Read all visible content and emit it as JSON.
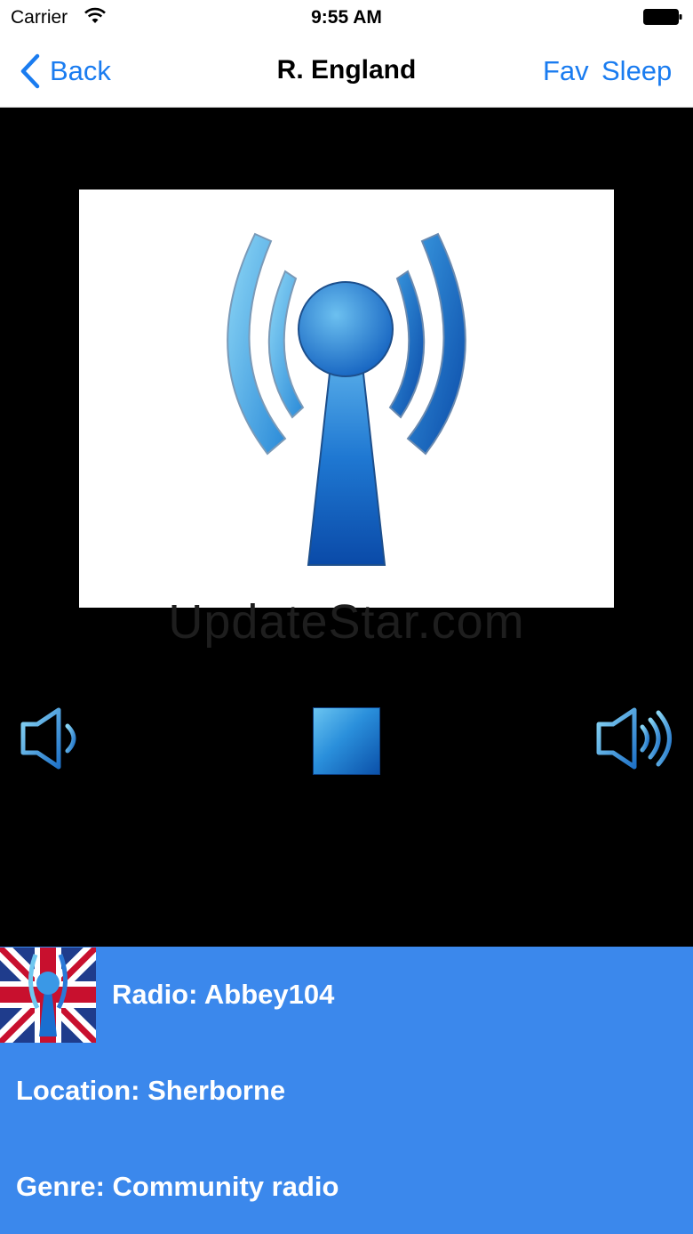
{
  "status_bar": {
    "carrier": "Carrier",
    "time": "9:55 AM"
  },
  "nav": {
    "back_label": "Back",
    "title": "R. England",
    "fav_label": "Fav",
    "sleep_label": "Sleep"
  },
  "player": {
    "watermark": "UpdateStar.com"
  },
  "info": {
    "radio": "Radio: Abbey104",
    "location": "Location: Sherborne",
    "genre": "Genre: Community radio"
  },
  "icons": {
    "wifi": "wifi-icon",
    "battery": "battery-icon",
    "back": "chevron-left-icon",
    "artwork": "radio-antenna-icon",
    "volume_down": "volume-down-icon",
    "stop": "stop-icon",
    "volume_up": "volume-up-icon",
    "flag": "uk-flag-radio-icon"
  },
  "colors": {
    "accent": "#1a7cf0",
    "info_panel": "#3b88ec",
    "background": "#000000"
  }
}
